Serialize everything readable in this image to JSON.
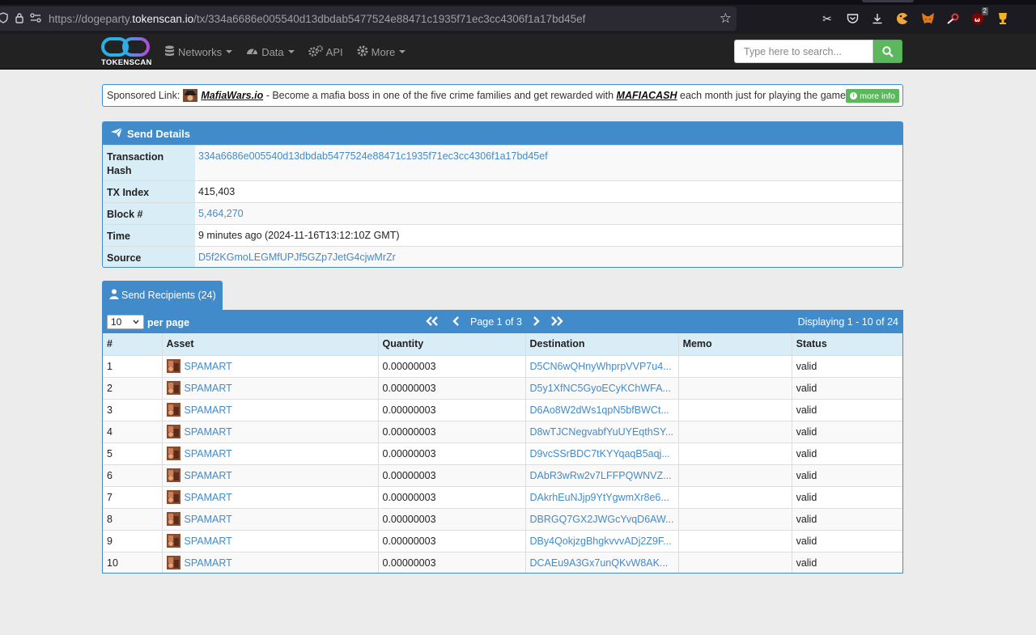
{
  "browser": {
    "url_prefix": "https://dogeparty.",
    "url_host": "tokenscan.io",
    "url_path": "/tx/334a6686e005540d13dbdab5477524e88471c1935f71ec3cc4306f1a17bd45ef",
    "ext_badge": "2"
  },
  "navbar": {
    "brand": "TOKENSCAN",
    "items": [
      {
        "label": "Networks",
        "icon": "database-icon"
      },
      {
        "label": "Data",
        "icon": "dashboard-icon"
      },
      {
        "label": "API",
        "icon": "cogs-icon"
      },
      {
        "label": "More",
        "icon": "gear-icon"
      }
    ],
    "search_placeholder": "Type here to search..."
  },
  "sponsor": {
    "prefix": "Sponsored Link:",
    "site": "MafiaWars.io",
    "text_before": " - Become a mafia boss in one of the five crime families and get rewarded with ",
    "token": "MAFIACASH",
    "text_after": " each month just for playing the game!",
    "more_info": "more info"
  },
  "details": {
    "title": "Send Details",
    "rows": [
      {
        "label": "Transaction Hash",
        "value": "334a6686e005540d13dbdab5477524e88471c1935f71ec3cc4306f1a17bd45ef"
      },
      {
        "label": "TX Index",
        "value": "415,403"
      },
      {
        "label": "Block #",
        "value": "5,464,270"
      },
      {
        "label": "Time",
        "value": "9 minutes ago (2024-11-16T13:12:10Z GMT)"
      },
      {
        "label": "Source",
        "value": "D5f2KGmoLEGMfUPJf5GZp7JetG4cjwMrZr"
      }
    ]
  },
  "recipients": {
    "tab_label": "Send Recipients (24)",
    "per_page_value": "10",
    "per_page_label": "per page",
    "page_text": "Page 1 of 3",
    "displaying": "Displaying 1 - 10 of 24",
    "columns": [
      "#",
      "Asset",
      "Quantity",
      "Destination",
      "Memo",
      "Status"
    ],
    "rows": [
      {
        "n": "1",
        "asset": "SPAMART",
        "qty": "0.00000003",
        "dest": "D5CN6wQHnyWhprpVVP7u4...",
        "memo": "",
        "status": "valid"
      },
      {
        "n": "2",
        "asset": "SPAMART",
        "qty": "0.00000003",
        "dest": "D5y1XfNC5GyoECyKChWFA...",
        "memo": "",
        "status": "valid"
      },
      {
        "n": "3",
        "asset": "SPAMART",
        "qty": "0.00000003",
        "dest": "D6Ao8W2dWs1qpN5bfBWCt...",
        "memo": "",
        "status": "valid"
      },
      {
        "n": "4",
        "asset": "SPAMART",
        "qty": "0.00000003",
        "dest": "D8wTJCNegvabfYuUYEqthSY...",
        "memo": "",
        "status": "valid"
      },
      {
        "n": "5",
        "asset": "SPAMART",
        "qty": "0.00000003",
        "dest": "D9vcSSrBDC7tKYYqaqB5aqj...",
        "memo": "",
        "status": "valid"
      },
      {
        "n": "6",
        "asset": "SPAMART",
        "qty": "0.00000003",
        "dest": "DAbR3wRw2v7LFFPQWNVZ...",
        "memo": "",
        "status": "valid"
      },
      {
        "n": "7",
        "asset": "SPAMART",
        "qty": "0.00000003",
        "dest": "DAkrhEuNJjp9YtYgwmXr8e6...",
        "memo": "",
        "status": "valid"
      },
      {
        "n": "8",
        "asset": "SPAMART",
        "qty": "0.00000003",
        "dest": "DBRGQ7GX2JWGcYvqD6AW...",
        "memo": "",
        "status": "valid"
      },
      {
        "n": "9",
        "asset": "SPAMART",
        "qty": "0.00000003",
        "dest": "DBy4QokjzgBhgkvvvADj2Z9F...",
        "memo": "",
        "status": "valid"
      },
      {
        "n": "10",
        "asset": "SPAMART",
        "qty": "0.00000003",
        "dest": "DCAEu9A3Gx7unQKvW8AK...",
        "memo": "",
        "status": "valid"
      }
    ]
  },
  "colors": {
    "accent": "#428bca",
    "success": "#5cb85c",
    "navbar": "#222222",
    "browser": "#1c1b22"
  }
}
